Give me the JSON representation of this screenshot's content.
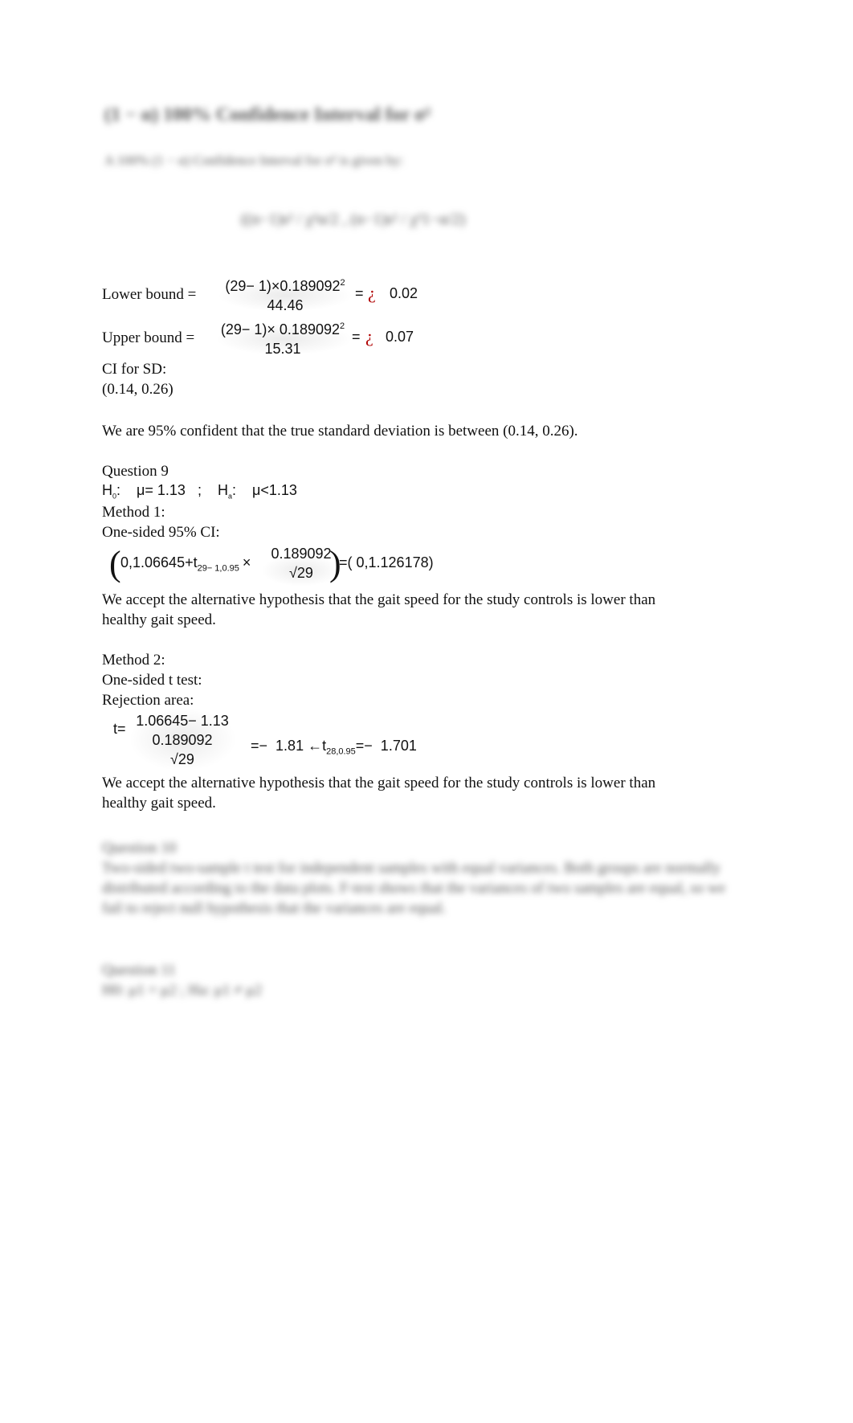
{
  "blurred_top": {
    "heading": "(1 − α) 100% Confidence Interval for σ²",
    "intro": "A 100% (1 − α) Confidence Interval for σ² is given by:",
    "formula": "((n−1)s² / χ²α/2 , (n−1)s² / χ²1−α/2)"
  },
  "lower_bound": {
    "label": "Lower bound =",
    "numerator": "(29− 1)×0.189092",
    "numerator_exp": "2",
    "denominator": "44.46",
    "equals": "=",
    "glyph": "¿",
    "result": "0.02"
  },
  "upper_bound": {
    "label": "Upper bound =",
    "numerator": "(29− 1)× 0.189092",
    "numerator_exp": "2",
    "denominator": "15.31",
    "equals": "=",
    "glyph": "¿",
    "result": "0.07"
  },
  "ci_sd": {
    "label": "CI for SD:",
    "value": "(0.14, 0.26)"
  },
  "conclusion_sd": "We are 95% confident that the true standard deviation is between (0.14, 0.26).",
  "question9": {
    "title": "Question 9",
    "h0_label": "H",
    "h0_sub": "0",
    "h0_expr": ":    μ= 1.13   ;",
    "ha_label": "H",
    "ha_sub": "a",
    "ha_expr": ":    μ<1.13",
    "method1": {
      "title": "Method 1:",
      "subtitle": "One-sided 95% CI:",
      "expr_left": "0,1.06645+t",
      "expr_sub": "29− 1,0.95",
      "times": "×",
      "frac_num": "0.189092",
      "frac_den": "√29",
      "result": "=( 0,1.126178)",
      "conclusion_line1": "We accept the alternative hypothesis that the gait speed for the study controls is lower than",
      "conclusion_line2": "healthy gait speed."
    },
    "method2": {
      "title": "Method 2:",
      "subtitle": "One-sided t test:",
      "rejection": "Rejection area:",
      "t_label": "t=",
      "t_num": "1.06645− 1.13",
      "t_den": "0.189092",
      "t_den2": "√29",
      "t_result": "=−  1.81 ←t",
      "t_sub": "28,0.95",
      "t_crit": "=−  1.701",
      "conclusion_line1": "We accept the alternative hypothesis that the gait speed for the study controls is lower than",
      "conclusion_line2": "healthy gait speed."
    }
  },
  "blurred_bottom": {
    "q10_title": "Question 10",
    "q10_body": "Two-sided two-sample t test for independent samples with equal variances. Both groups are normally distributed according to the data plots. F-test shows that the variances of two samples are equal, so we fail to reject null hypothesis that the variances are equal.",
    "q11_title": "Question 11",
    "q11_hyp": "H0: μ1 = μ2 ;  Ha: μ1 ≠ μ2"
  }
}
